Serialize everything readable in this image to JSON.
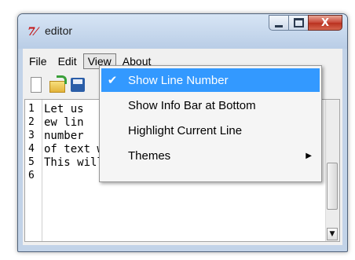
{
  "window": {
    "title": "editor",
    "app_icon": "tk-feather-icon"
  },
  "window_controls": {
    "minimize": "minimize-icon",
    "maximize": "maximize-icon",
    "close_glyph": "X"
  },
  "menubar": {
    "items": [
      "File",
      "Edit",
      "View",
      "About"
    ],
    "active": "View"
  },
  "toolbar": {
    "buttons": [
      "new-file-icon",
      "open-folder-icon",
      "save-icon"
    ]
  },
  "editor": {
    "line_numbers": [
      "1",
      "2",
      "3",
      "4",
      "5",
      "6"
    ],
    "lines": [
      "Let us",
      "ew lin",
      "number",
      "of text widget.",
      "This will require us to d",
      ""
    ]
  },
  "view_menu": {
    "items": [
      {
        "label": "Show Line Number",
        "checked": true,
        "highlighted": true
      },
      {
        "label": "Show Info Bar at Bottom",
        "checked": false,
        "highlighted": false
      },
      {
        "label": "Highlight Current Line",
        "checked": false,
        "highlighted": false
      },
      {
        "label": "Themes",
        "checked": false,
        "highlighted": false,
        "submenu": true
      }
    ],
    "check_glyph": "✔",
    "submenu_glyph": "▶"
  },
  "colors": {
    "highlight": "#3399ff",
    "titlebar": "#c2d3e8",
    "close": "#c74535"
  }
}
